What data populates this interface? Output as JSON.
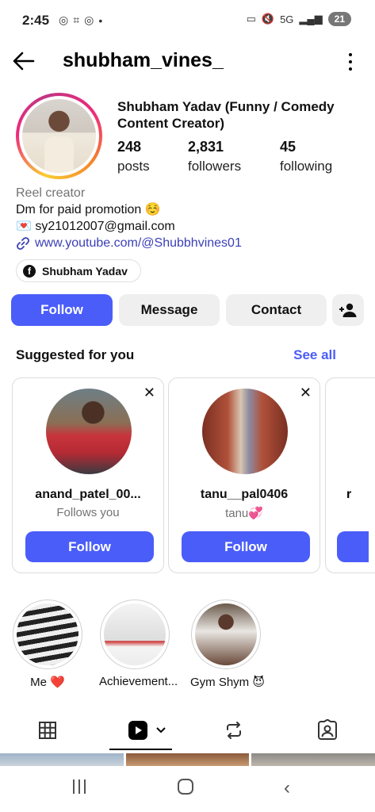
{
  "status_bar": {
    "time": "2:45",
    "battery": "21",
    "network": "5G"
  },
  "header": {
    "username": "shubham_vines_"
  },
  "profile": {
    "full_name": "Shubham Yadav (Funny / Comedy Content Creator)",
    "stats": [
      {
        "value": "248",
        "label": "posts"
      },
      {
        "value": "2,831",
        "label": "followers"
      },
      {
        "value": "45",
        "label": "following"
      }
    ],
    "category": "Reel creator",
    "bio_line1": "Dm for paid promotion ☺️",
    "bio_email": "💌 sy21012007@gmail.com",
    "bio_link": "www.youtube.com/@Shubbhvines01",
    "facebook_name": "Shubham Yadav"
  },
  "actions": {
    "follow": "Follow",
    "message": "Message",
    "contact": "Contact"
  },
  "suggested": {
    "title": "Suggested for you",
    "see_all": "See all",
    "cards": [
      {
        "username": "anand_patel_00...",
        "subtitle": "Follows you",
        "button": "Follow"
      },
      {
        "username": "tanu__pal0406",
        "subtitle": "tanu💞",
        "button": "Follow"
      },
      {
        "username": "r",
        "subtitle": "",
        "button": ""
      }
    ]
  },
  "highlights": [
    {
      "label": "Me ❤️"
    },
    {
      "label": "Achievement..."
    },
    {
      "label": "Gym Shym 😈"
    }
  ],
  "colors": {
    "accent": "#4a5df9",
    "link": "#3b3fb5",
    "secondary_button": "#efefef"
  }
}
